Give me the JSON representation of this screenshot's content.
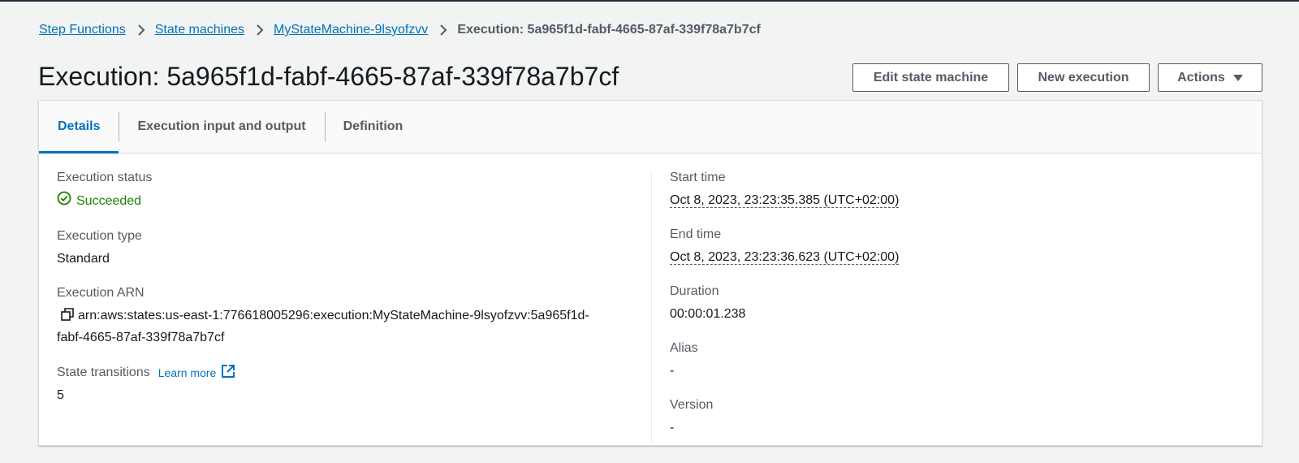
{
  "breadcrumb": {
    "items": [
      "Step Functions",
      "State machines",
      "MyStateMachine-9lsyofzvv"
    ],
    "current": "Execution: 5a965f1d-fabf-4665-87af-339f78a7b7cf"
  },
  "header": {
    "title": "Execution: 5a965f1d-fabf-4665-87af-339f78a7b7cf",
    "buttons": {
      "edit": "Edit state machine",
      "new_execution": "New execution",
      "actions": "Actions"
    }
  },
  "tabs": [
    {
      "label": "Details",
      "active": true
    },
    {
      "label": "Execution input and output",
      "active": false
    },
    {
      "label": "Definition",
      "active": false
    }
  ],
  "details": {
    "left": {
      "status_label": "Execution status",
      "status_value": "Succeeded",
      "type_label": "Execution type",
      "type_value": "Standard",
      "arn_label": "Execution ARN",
      "arn_line1": "arn:aws:states:us-east-1:776618005296:execution:MyStateMachine-9lsyofzvv:5a965f1d-",
      "arn_line2": "fabf-4665-87af-339f78a7b7cf",
      "transitions_label": "State transitions",
      "learn_more": "Learn more",
      "transitions_value": "5"
    },
    "right": {
      "start_label": "Start time",
      "start_value": "Oct 8, 2023, 23:23:35.385 (UTC+02:00)",
      "end_label": "End time",
      "end_value": "Oct 8, 2023, 23:23:36.623 (UTC+02:00)",
      "duration_label": "Duration",
      "duration_value": "00:00:01.238",
      "alias_label": "Alias",
      "alias_value": "-",
      "version_label": "Version",
      "version_value": "-"
    }
  },
  "colors": {
    "link": "#0073bb",
    "success": "#1d8102",
    "text": "#16191f",
    "muted": "#545b64",
    "background": "#f2f3f3"
  },
  "icons": {
    "crumb_separator": "chevron-right-icon",
    "status": "check-circle-icon",
    "copy": "copy-icon",
    "external": "external-link-icon",
    "actions_caret": "caret-down-icon"
  }
}
